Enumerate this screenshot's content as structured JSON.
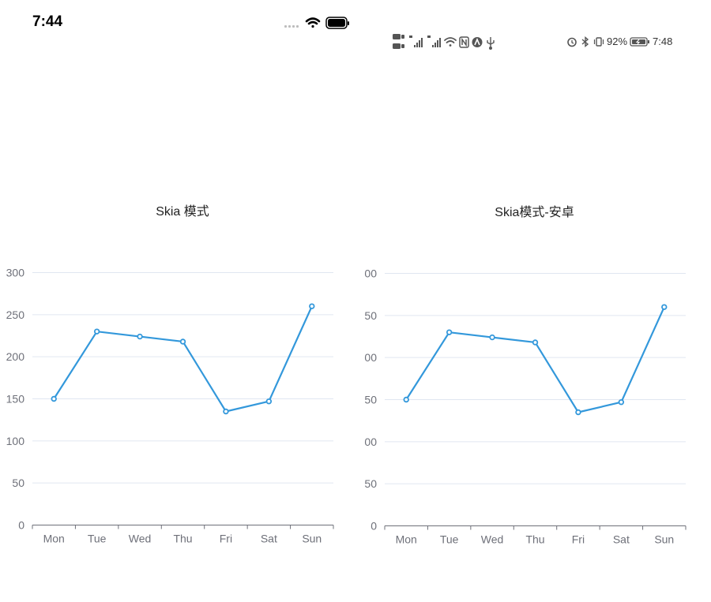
{
  "left_panel": {
    "status_bar": {
      "time": "7:44",
      "icons": [
        "signal-dots-icon",
        "wifi-icon",
        "battery-icon"
      ]
    },
    "title": "Skia 模式"
  },
  "right_panel": {
    "status_bar": {
      "left_icons": [
        "hd-volte-icon",
        "signal-4g-icon",
        "signal-4g-icon",
        "wifi-icon",
        "nfc-icon",
        "app-a-icon",
        "usb-icon"
      ],
      "right_icons": [
        "alarm-icon",
        "bluetooth-icon",
        "vibrate-icon"
      ],
      "battery": "92%",
      "time": "7:48"
    },
    "title": "Skia模式-安卓"
  },
  "chart_data": [
    {
      "type": "line",
      "title": "Skia 模式",
      "categories": [
        "Mon",
        "Tue",
        "Wed",
        "Thu",
        "Fri",
        "Sat",
        "Sun"
      ],
      "values": [
        150,
        230,
        224,
        218,
        135,
        147,
        260
      ],
      "y_ticks": [
        "0",
        "50",
        "100",
        "150",
        "200",
        "250",
        "300"
      ],
      "ylim": [
        0,
        300
      ],
      "grid": true,
      "color": "#3398DB"
    },
    {
      "type": "line",
      "title": "Skia模式-安卓",
      "categories": [
        "Mon",
        "Tue",
        "Wed",
        "Thu",
        "Fri",
        "Sat",
        "Sun"
      ],
      "values": [
        150,
        230,
        224,
        218,
        135,
        147,
        260
      ],
      "y_ticks": [
        "0",
        "50",
        "00",
        "50",
        "00",
        "50",
        "00"
      ],
      "ylim": [
        0,
        300
      ],
      "grid": true,
      "color": "#3398DB"
    }
  ]
}
